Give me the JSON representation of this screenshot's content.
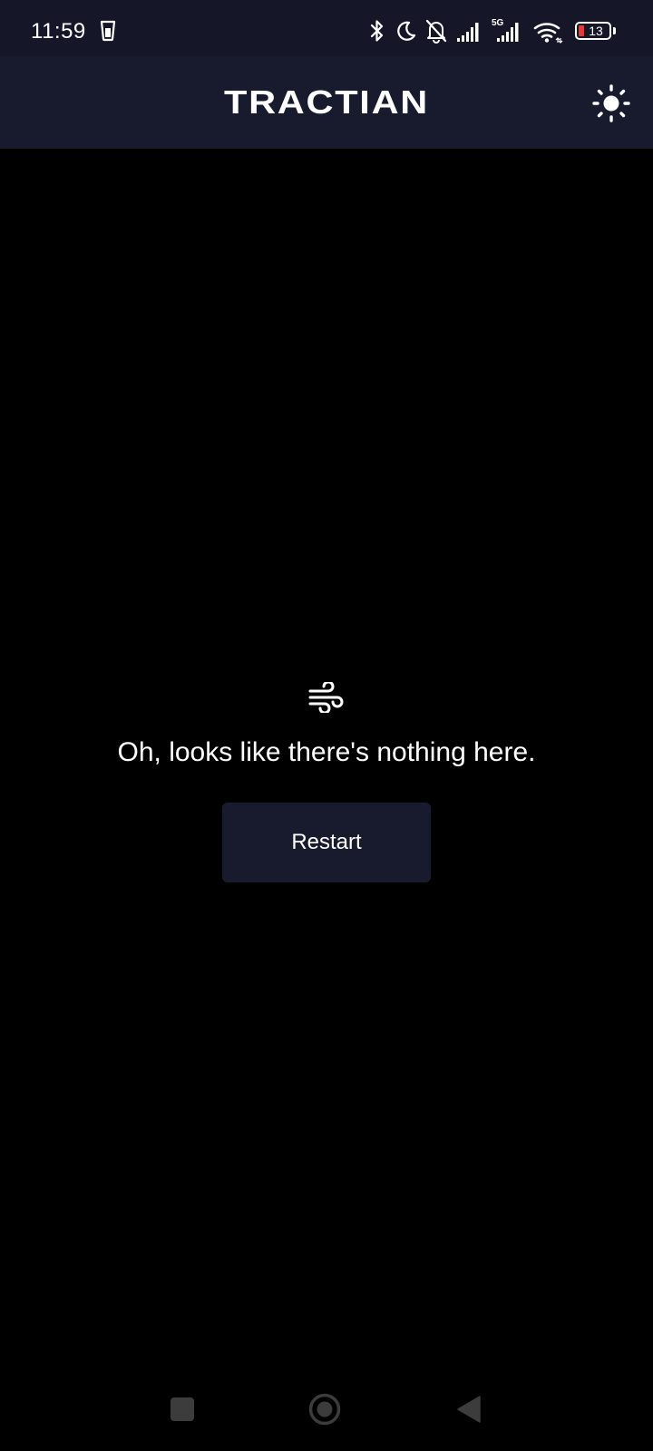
{
  "status_bar": {
    "time": "11:59",
    "battery_level": "13",
    "network_label": "5G",
    "icons": [
      "sim-card-icon",
      "bluetooth-icon",
      "moon-icon",
      "bell-off-icon",
      "signal-icon",
      "signal-5g-icon",
      "wifi-icon",
      "battery-icon"
    ]
  },
  "header": {
    "brand": "TRACTIAN",
    "theme_toggle_icon": "sun-icon",
    "background": "#181b2e"
  },
  "main": {
    "icon": "wind-icon",
    "message": "Oh, looks like there's nothing here.",
    "restart_label": "Restart",
    "background": "#000000"
  },
  "nav_bar": {
    "icons": [
      "recents-square-icon",
      "home-circle-icon",
      "back-triangle-icon"
    ]
  }
}
